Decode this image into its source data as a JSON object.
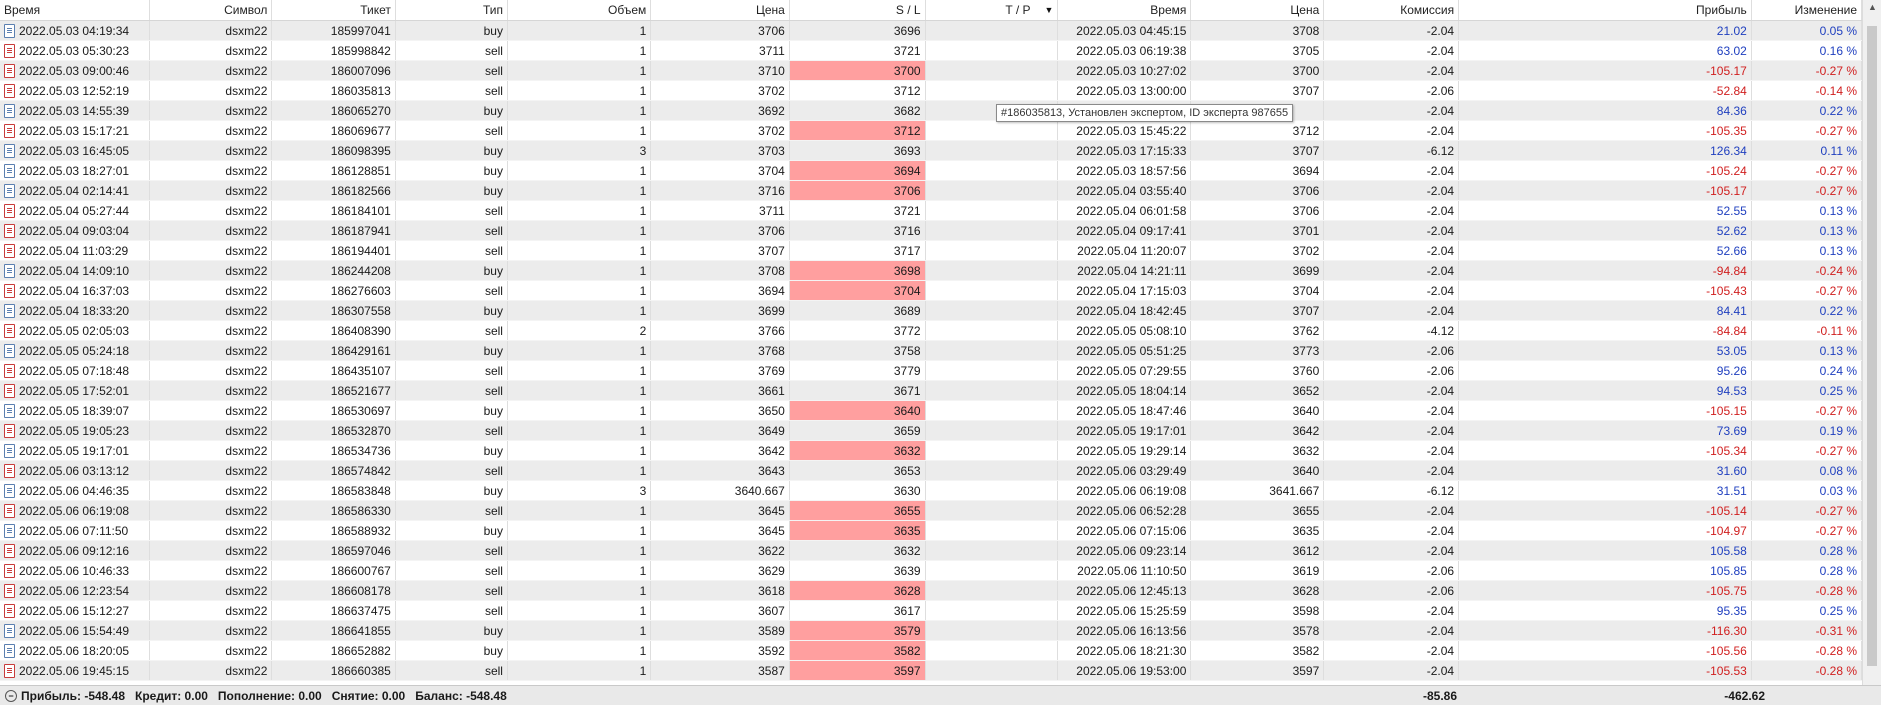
{
  "columns": [
    "Время",
    "Символ",
    "Тикет",
    "Тип",
    "Объем",
    "Цена",
    "S / L",
    "T / P",
    "Время",
    "Цена",
    "Комиссия",
    "Прибыль",
    "Изменение"
  ],
  "sort_indicator": "▼",
  "tooltip": "#186035813, Установлен экспертом, ID эксперта 987655",
  "rows": [
    {
      "time": "2022.05.03 04:19:34",
      "symbol": "dsxm22",
      "ticket": "185997041",
      "type": "buy",
      "volume": "1",
      "price": "3706",
      "sl": "3696",
      "sl_hit": false,
      "tp": "",
      "close_time": "2022.05.03 04:45:15",
      "close_price": "3708",
      "commission": "-2.04",
      "profit": "21.02",
      "change": "0.05 %"
    },
    {
      "time": "2022.05.03 05:30:23",
      "symbol": "dsxm22",
      "ticket": "185998842",
      "type": "sell",
      "volume": "1",
      "price": "3711",
      "sl": "3721",
      "sl_hit": false,
      "tp": "",
      "close_time": "2022.05.03 06:19:38",
      "close_price": "3705",
      "commission": "-2.04",
      "profit": "63.02",
      "change": "0.16 %"
    },
    {
      "time": "2022.05.03 09:00:46",
      "symbol": "dsxm22",
      "ticket": "186007096",
      "type": "sell",
      "volume": "1",
      "price": "3710",
      "sl": "3700",
      "sl_hit": true,
      "tp": "",
      "close_time": "2022.05.03 10:27:02",
      "close_price": "3700",
      "commission": "-2.04",
      "profit": "-105.17",
      "change": "-0.27 %"
    },
    {
      "time": "2022.05.03 12:52:19",
      "symbol": "dsxm22",
      "ticket": "186035813",
      "type": "sell",
      "volume": "1",
      "price": "3702",
      "sl": "3712",
      "sl_hit": false,
      "tp": "",
      "close_time": "2022.05.03 13:00:00",
      "close_price": "3707",
      "commission": "-2.06",
      "profit": "-52.84",
      "change": "-0.14 %"
    },
    {
      "time": "2022.05.03 14:55:39",
      "symbol": "dsxm22",
      "ticket": "186065270",
      "type": "buy",
      "volume": "1",
      "price": "3692",
      "sl": "3682",
      "sl_hit": false,
      "tp": "",
      "close_time": "",
      "close_price": "",
      "commission": "-2.04",
      "profit": "84.36",
      "change": "0.22 %"
    },
    {
      "time": "2022.05.03 15:17:21",
      "symbol": "dsxm22",
      "ticket": "186069677",
      "type": "sell",
      "volume": "1",
      "price": "3702",
      "sl": "3712",
      "sl_hit": true,
      "tp": "",
      "close_time": "2022.05.03 15:45:22",
      "close_price": "3712",
      "commission": "-2.04",
      "profit": "-105.35",
      "change": "-0.27 %"
    },
    {
      "time": "2022.05.03 16:45:05",
      "symbol": "dsxm22",
      "ticket": "186098395",
      "type": "buy",
      "volume": "3",
      "price": "3703",
      "sl": "3693",
      "sl_hit": false,
      "tp": "",
      "close_time": "2022.05.03 17:15:33",
      "close_price": "3707",
      "commission": "-6.12",
      "profit": "126.34",
      "change": "0.11 %"
    },
    {
      "time": "2022.05.03 18:27:01",
      "symbol": "dsxm22",
      "ticket": "186128851",
      "type": "buy",
      "volume": "1",
      "price": "3704",
      "sl": "3694",
      "sl_hit": true,
      "tp": "",
      "close_time": "2022.05.03 18:57:56",
      "close_price": "3694",
      "commission": "-2.04",
      "profit": "-105.24",
      "change": "-0.27 %"
    },
    {
      "time": "2022.05.04 02:14:41",
      "symbol": "dsxm22",
      "ticket": "186182566",
      "type": "buy",
      "volume": "1",
      "price": "3716",
      "sl": "3706",
      "sl_hit": true,
      "tp": "",
      "close_time": "2022.05.04 03:55:40",
      "close_price": "3706",
      "commission": "-2.04",
      "profit": "-105.17",
      "change": "-0.27 %"
    },
    {
      "time": "2022.05.04 05:27:44",
      "symbol": "dsxm22",
      "ticket": "186184101",
      "type": "sell",
      "volume": "1",
      "price": "3711",
      "sl": "3721",
      "sl_hit": false,
      "tp": "",
      "close_time": "2022.05.04 06:01:58",
      "close_price": "3706",
      "commission": "-2.04",
      "profit": "52.55",
      "change": "0.13 %"
    },
    {
      "time": "2022.05.04 09:03:04",
      "symbol": "dsxm22",
      "ticket": "186187941",
      "type": "sell",
      "volume": "1",
      "price": "3706",
      "sl": "3716",
      "sl_hit": false,
      "tp": "",
      "close_time": "2022.05.04 09:17:41",
      "close_price": "3701",
      "commission": "-2.04",
      "profit": "52.62",
      "change": "0.13 %"
    },
    {
      "time": "2022.05.04 11:03:29",
      "symbol": "dsxm22",
      "ticket": "186194401",
      "type": "sell",
      "volume": "1",
      "price": "3707",
      "sl": "3717",
      "sl_hit": false,
      "tp": "",
      "close_time": "2022.05.04 11:20:07",
      "close_price": "3702",
      "commission": "-2.04",
      "profit": "52.66",
      "change": "0.13 %"
    },
    {
      "time": "2022.05.04 14:09:10",
      "symbol": "dsxm22",
      "ticket": "186244208",
      "type": "buy",
      "volume": "1",
      "price": "3708",
      "sl": "3698",
      "sl_hit": true,
      "tp": "",
      "close_time": "2022.05.04 14:21:11",
      "close_price": "3699",
      "commission": "-2.04",
      "profit": "-94.84",
      "change": "-0.24 %"
    },
    {
      "time": "2022.05.04 16:37:03",
      "symbol": "dsxm22",
      "ticket": "186276603",
      "type": "sell",
      "volume": "1",
      "price": "3694",
      "sl": "3704",
      "sl_hit": true,
      "tp": "",
      "close_time": "2022.05.04 17:15:03",
      "close_price": "3704",
      "commission": "-2.04",
      "profit": "-105.43",
      "change": "-0.27 %"
    },
    {
      "time": "2022.05.04 18:33:20",
      "symbol": "dsxm22",
      "ticket": "186307558",
      "type": "buy",
      "volume": "1",
      "price": "3699",
      "sl": "3689",
      "sl_hit": false,
      "tp": "",
      "close_time": "2022.05.04 18:42:45",
      "close_price": "3707",
      "commission": "-2.04",
      "profit": "84.41",
      "change": "0.22 %"
    },
    {
      "time": "2022.05.05 02:05:03",
      "symbol": "dsxm22",
      "ticket": "186408390",
      "type": "sell",
      "volume": "2",
      "price": "3766",
      "sl": "3772",
      "sl_hit": false,
      "tp": "",
      "close_time": "2022.05.05 05:08:10",
      "close_price": "3762",
      "commission": "-4.12",
      "profit": "-84.84",
      "change": "-0.11 %"
    },
    {
      "time": "2022.05.05 05:24:18",
      "symbol": "dsxm22",
      "ticket": "186429161",
      "type": "buy",
      "volume": "1",
      "price": "3768",
      "sl": "3758",
      "sl_hit": false,
      "tp": "",
      "close_time": "2022.05.05 05:51:25",
      "close_price": "3773",
      "commission": "-2.06",
      "profit": "53.05",
      "change": "0.13 %"
    },
    {
      "time": "2022.05.05 07:18:48",
      "symbol": "dsxm22",
      "ticket": "186435107",
      "type": "sell",
      "volume": "1",
      "price": "3769",
      "sl": "3779",
      "sl_hit": false,
      "tp": "",
      "close_time": "2022.05.05 07:29:55",
      "close_price": "3760",
      "commission": "-2.06",
      "profit": "95.26",
      "change": "0.24 %"
    },
    {
      "time": "2022.05.05 17:52:01",
      "symbol": "dsxm22",
      "ticket": "186521677",
      "type": "sell",
      "volume": "1",
      "price": "3661",
      "sl": "3671",
      "sl_hit": false,
      "tp": "",
      "close_time": "2022.05.05 18:04:14",
      "close_price": "3652",
      "commission": "-2.04",
      "profit": "94.53",
      "change": "0.25 %"
    },
    {
      "time": "2022.05.05 18:39:07",
      "symbol": "dsxm22",
      "ticket": "186530697",
      "type": "buy",
      "volume": "1",
      "price": "3650",
      "sl": "3640",
      "sl_hit": true,
      "tp": "",
      "close_time": "2022.05.05 18:47:46",
      "close_price": "3640",
      "commission": "-2.04",
      "profit": "-105.15",
      "change": "-0.27 %"
    },
    {
      "time": "2022.05.05 19:05:23",
      "symbol": "dsxm22",
      "ticket": "186532870",
      "type": "sell",
      "volume": "1",
      "price": "3649",
      "sl": "3659",
      "sl_hit": false,
      "tp": "",
      "close_time": "2022.05.05 19:17:01",
      "close_price": "3642",
      "commission": "-2.04",
      "profit": "73.69",
      "change": "0.19 %"
    },
    {
      "time": "2022.05.05 19:17:01",
      "symbol": "dsxm22",
      "ticket": "186534736",
      "type": "buy",
      "volume": "1",
      "price": "3642",
      "sl": "3632",
      "sl_hit": true,
      "tp": "",
      "close_time": "2022.05.05 19:29:14",
      "close_price": "3632",
      "commission": "-2.04",
      "profit": "-105.34",
      "change": "-0.27 %"
    },
    {
      "time": "2022.05.06 03:13:12",
      "symbol": "dsxm22",
      "ticket": "186574842",
      "type": "sell",
      "volume": "1",
      "price": "3643",
      "sl": "3653",
      "sl_hit": false,
      "tp": "",
      "close_time": "2022.05.06 03:29:49",
      "close_price": "3640",
      "commission": "-2.04",
      "profit": "31.60",
      "change": "0.08 %"
    },
    {
      "time": "2022.05.06 04:46:35",
      "symbol": "dsxm22",
      "ticket": "186583848",
      "type": "buy",
      "volume": "3",
      "price": "3640.667",
      "sl": "3630",
      "sl_hit": false,
      "tp": "",
      "close_time": "2022.05.06 06:19:08",
      "close_price": "3641.667",
      "commission": "-6.12",
      "profit": "31.51",
      "change": "0.03 %"
    },
    {
      "time": "2022.05.06 06:19:08",
      "symbol": "dsxm22",
      "ticket": "186586330",
      "type": "sell",
      "volume": "1",
      "price": "3645",
      "sl": "3655",
      "sl_hit": true,
      "tp": "",
      "close_time": "2022.05.06 06:52:28",
      "close_price": "3655",
      "commission": "-2.04",
      "profit": "-105.14",
      "change": "-0.27 %"
    },
    {
      "time": "2022.05.06 07:11:50",
      "symbol": "dsxm22",
      "ticket": "186588932",
      "type": "buy",
      "volume": "1",
      "price": "3645",
      "sl": "3635",
      "sl_hit": true,
      "tp": "",
      "close_time": "2022.05.06 07:15:06",
      "close_price": "3635",
      "commission": "-2.04",
      "profit": "-104.97",
      "change": "-0.27 %"
    },
    {
      "time": "2022.05.06 09:12:16",
      "symbol": "dsxm22",
      "ticket": "186597046",
      "type": "sell",
      "volume": "1",
      "price": "3622",
      "sl": "3632",
      "sl_hit": false,
      "tp": "",
      "close_time": "2022.05.06 09:23:14",
      "close_price": "3612",
      "commission": "-2.04",
      "profit": "105.58",
      "change": "0.28 %"
    },
    {
      "time": "2022.05.06 10:46:33",
      "symbol": "dsxm22",
      "ticket": "186600767",
      "type": "sell",
      "volume": "1",
      "price": "3629",
      "sl": "3639",
      "sl_hit": false,
      "tp": "",
      "close_time": "2022.05.06 11:10:50",
      "close_price": "3619",
      "commission": "-2.06",
      "profit": "105.85",
      "change": "0.28 %"
    },
    {
      "time": "2022.05.06 12:23:54",
      "symbol": "dsxm22",
      "ticket": "186608178",
      "type": "sell",
      "volume": "1",
      "price": "3618",
      "sl": "3628",
      "sl_hit": true,
      "tp": "",
      "close_time": "2022.05.06 12:45:13",
      "close_price": "3628",
      "commission": "-2.06",
      "profit": "-105.75",
      "change": "-0.28 %"
    },
    {
      "time": "2022.05.06 15:12:27",
      "symbol": "dsxm22",
      "ticket": "186637475",
      "type": "sell",
      "volume": "1",
      "price": "3607",
      "sl": "3617",
      "sl_hit": false,
      "tp": "",
      "close_time": "2022.05.06 15:25:59",
      "close_price": "3598",
      "commission": "-2.04",
      "profit": "95.35",
      "change": "0.25 %"
    },
    {
      "time": "2022.05.06 15:54:49",
      "symbol": "dsxm22",
      "ticket": "186641855",
      "type": "buy",
      "volume": "1",
      "price": "3589",
      "sl": "3579",
      "sl_hit": true,
      "tp": "",
      "close_time": "2022.05.06 16:13:56",
      "close_price": "3578",
      "commission": "-2.04",
      "profit": "-116.30",
      "change": "-0.31 %"
    },
    {
      "time": "2022.05.06 18:20:05",
      "symbol": "dsxm22",
      "ticket": "186652882",
      "type": "buy",
      "volume": "1",
      "price": "3592",
      "sl": "3582",
      "sl_hit": true,
      "tp": "",
      "close_time": "2022.05.06 18:21:30",
      "close_price": "3582",
      "commission": "-2.04",
      "profit": "-105.56",
      "change": "-0.28 %"
    },
    {
      "time": "2022.05.06 19:45:15",
      "symbol": "dsxm22",
      "ticket": "186660385",
      "type": "sell",
      "volume": "1",
      "price": "3587",
      "sl": "3597",
      "sl_hit": true,
      "tp": "",
      "close_time": "2022.05.06 19:53:00",
      "close_price": "3597",
      "commission": "-2.04",
      "profit": "-105.53",
      "change": "-0.28 %"
    }
  ],
  "footer": {
    "profit": "Прибыль: -548.48",
    "credit": "Кредит: 0.00",
    "deposit": "Пополнение: 0.00",
    "withdrawal": "Снятие: 0.00",
    "balance": "Баланс: -548.48",
    "commission_total": "-85.86",
    "profit_total": "-462.62"
  },
  "colors": {
    "sl_hit_bg": "#ff9f9f",
    "profit_positive": "#1f3fbf",
    "profit_negative": "#d01e1e",
    "alt_row": "#ececec",
    "buy_icon": "#5a7fb0",
    "sell_icon": "#c83b3b"
  }
}
